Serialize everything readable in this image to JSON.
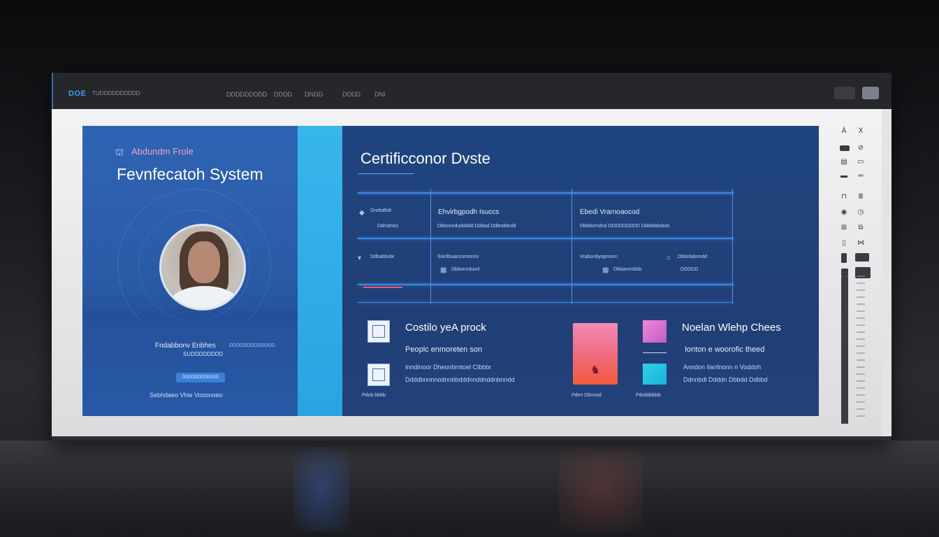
{
  "titlebar": {
    "brand": "DOE",
    "brand_sub": "TUDDDDDDDDDD",
    "nav": [
      "DDDDDDDDD",
      "DDDD",
      "DNDD",
      "DDDD",
      "DNI"
    ]
  },
  "hero": {
    "org": "Abdundm Frole",
    "title": "Fevnfecatoh System",
    "name": "Fndabbonv Enbhes",
    "name_sub": "DDDDDDDDDDDDD",
    "role": "SUDDDDDDDD",
    "button_label": "DDDDDDDDDDDD",
    "footer": "Sebhdaeo Vhie   Vooonoeo"
  },
  "main": {
    "title": "Certificconor Dvste",
    "table": {
      "headers": [
        "Ehvirbgpodh Isuccs",
        "Ebedi Vrarnoaocod"
      ],
      "row1": {
        "left_label": "Dnebdhttl",
        "left_sub": "Ddmdnbs",
        "mid_sub": "Dbbonnduddddd Dddad   Ddbnddndd",
        "right_sub": "Dbbdorndnd  DDDDDDDDD   Dbbdddobod"
      },
      "row2": {
        "left_label": "Ddbabbnbr",
        "mid_label": "Ssinlbuancomnnnn",
        "mid_sub": "Dbbonnduod",
        "right_label": "Vrabonbyoproorn",
        "right_sub": "Dbbannnbbb",
        "far_label": "Dbbnbdomdd",
        "far_sub": "DDDDD"
      }
    },
    "section_left": {
      "title": "Costilo yeA prock",
      "subtitle": "Peoplc enmoreten son",
      "line1": "Inndinoor Dheonbrntoel Clbbbr",
      "line2": "Ddddbnnnnodnnbbdddnnddnddnbnndd",
      "caption": "Pdob bbbb"
    },
    "section_mid": {
      "caption": "Pden Dbnnod"
    },
    "section_right": {
      "title": "Noelan Wlehp Chees",
      "subtitle": "Ionton e woorofic theed",
      "line1": "Anndon  Ilanfnonn n Voddoh",
      "line2": "Ddnnbdl  Ddddn Dbbdd  Ddbbd",
      "caption": "Pdnbbbbbb"
    }
  },
  "colors": {
    "hero_blue": "#2f64b4",
    "cyan_strip": "#37b6ec",
    "main_navy": "#1f447f",
    "accent_pink": "#f06a9a",
    "accent_cyan": "#2fd0ec"
  },
  "icons": [
    "avatar",
    "document-icon",
    "diagram-icon",
    "book-icon",
    "tile-icon",
    "toolbar-icons",
    "scrollbar"
  ]
}
